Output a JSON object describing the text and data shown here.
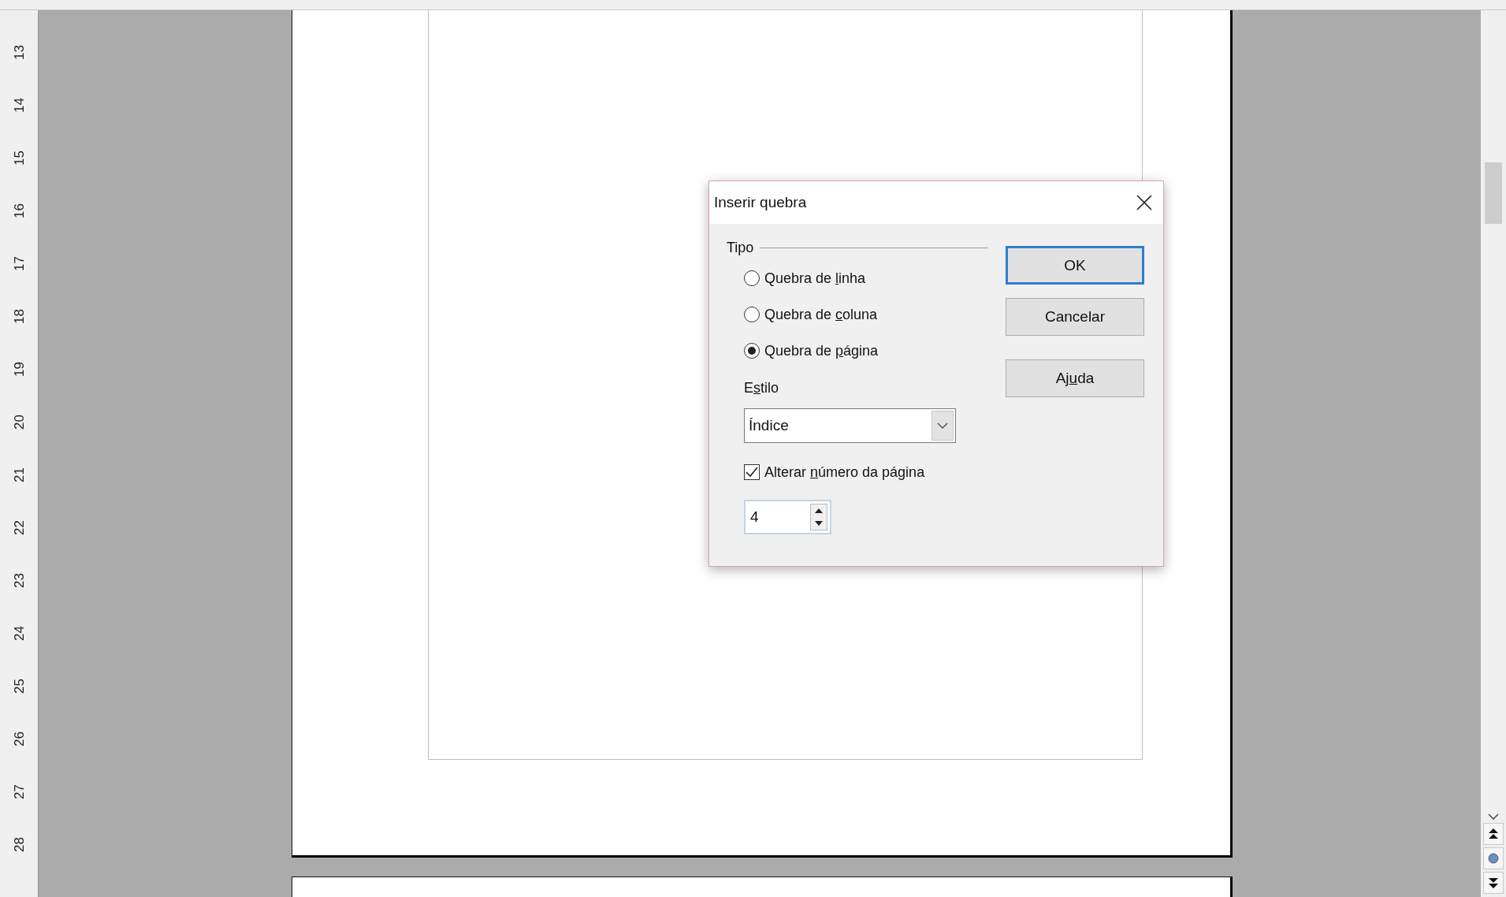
{
  "ruler": {
    "marks": [
      "13",
      "14",
      "15",
      "16",
      "17",
      "18",
      "19",
      "20",
      "21",
      "22",
      "23",
      "24",
      "25",
      "26",
      "27",
      "28"
    ]
  },
  "dialog": {
    "title": "Inserir quebra",
    "type_group": {
      "label": "Tipo",
      "options": [
        {
          "label_parts": [
            "Quebra de ",
            "l",
            "inha"
          ],
          "selected": false
        },
        {
          "label_parts": [
            "Quebra de ",
            "c",
            "oluna"
          ],
          "selected": false
        },
        {
          "label_parts": [
            "Quebra de ",
            "p",
            "ágina"
          ],
          "selected": true
        }
      ]
    },
    "style": {
      "label_parts": [
        "E",
        "s",
        "tilo"
      ],
      "value": "Índice"
    },
    "change_page_number": {
      "label_parts": [
        "Alterar ",
        "n",
        "úmero da página"
      ],
      "checked": true
    },
    "page_number": {
      "value": "4"
    },
    "buttons": [
      {
        "label_parts": [
          "OK"
        ],
        "default": true
      },
      {
        "label_parts": [
          "Cancelar"
        ],
        "default": false
      },
      {
        "label_parts": [
          "Aj",
          "u",
          "da"
        ],
        "default": false
      }
    ]
  }
}
